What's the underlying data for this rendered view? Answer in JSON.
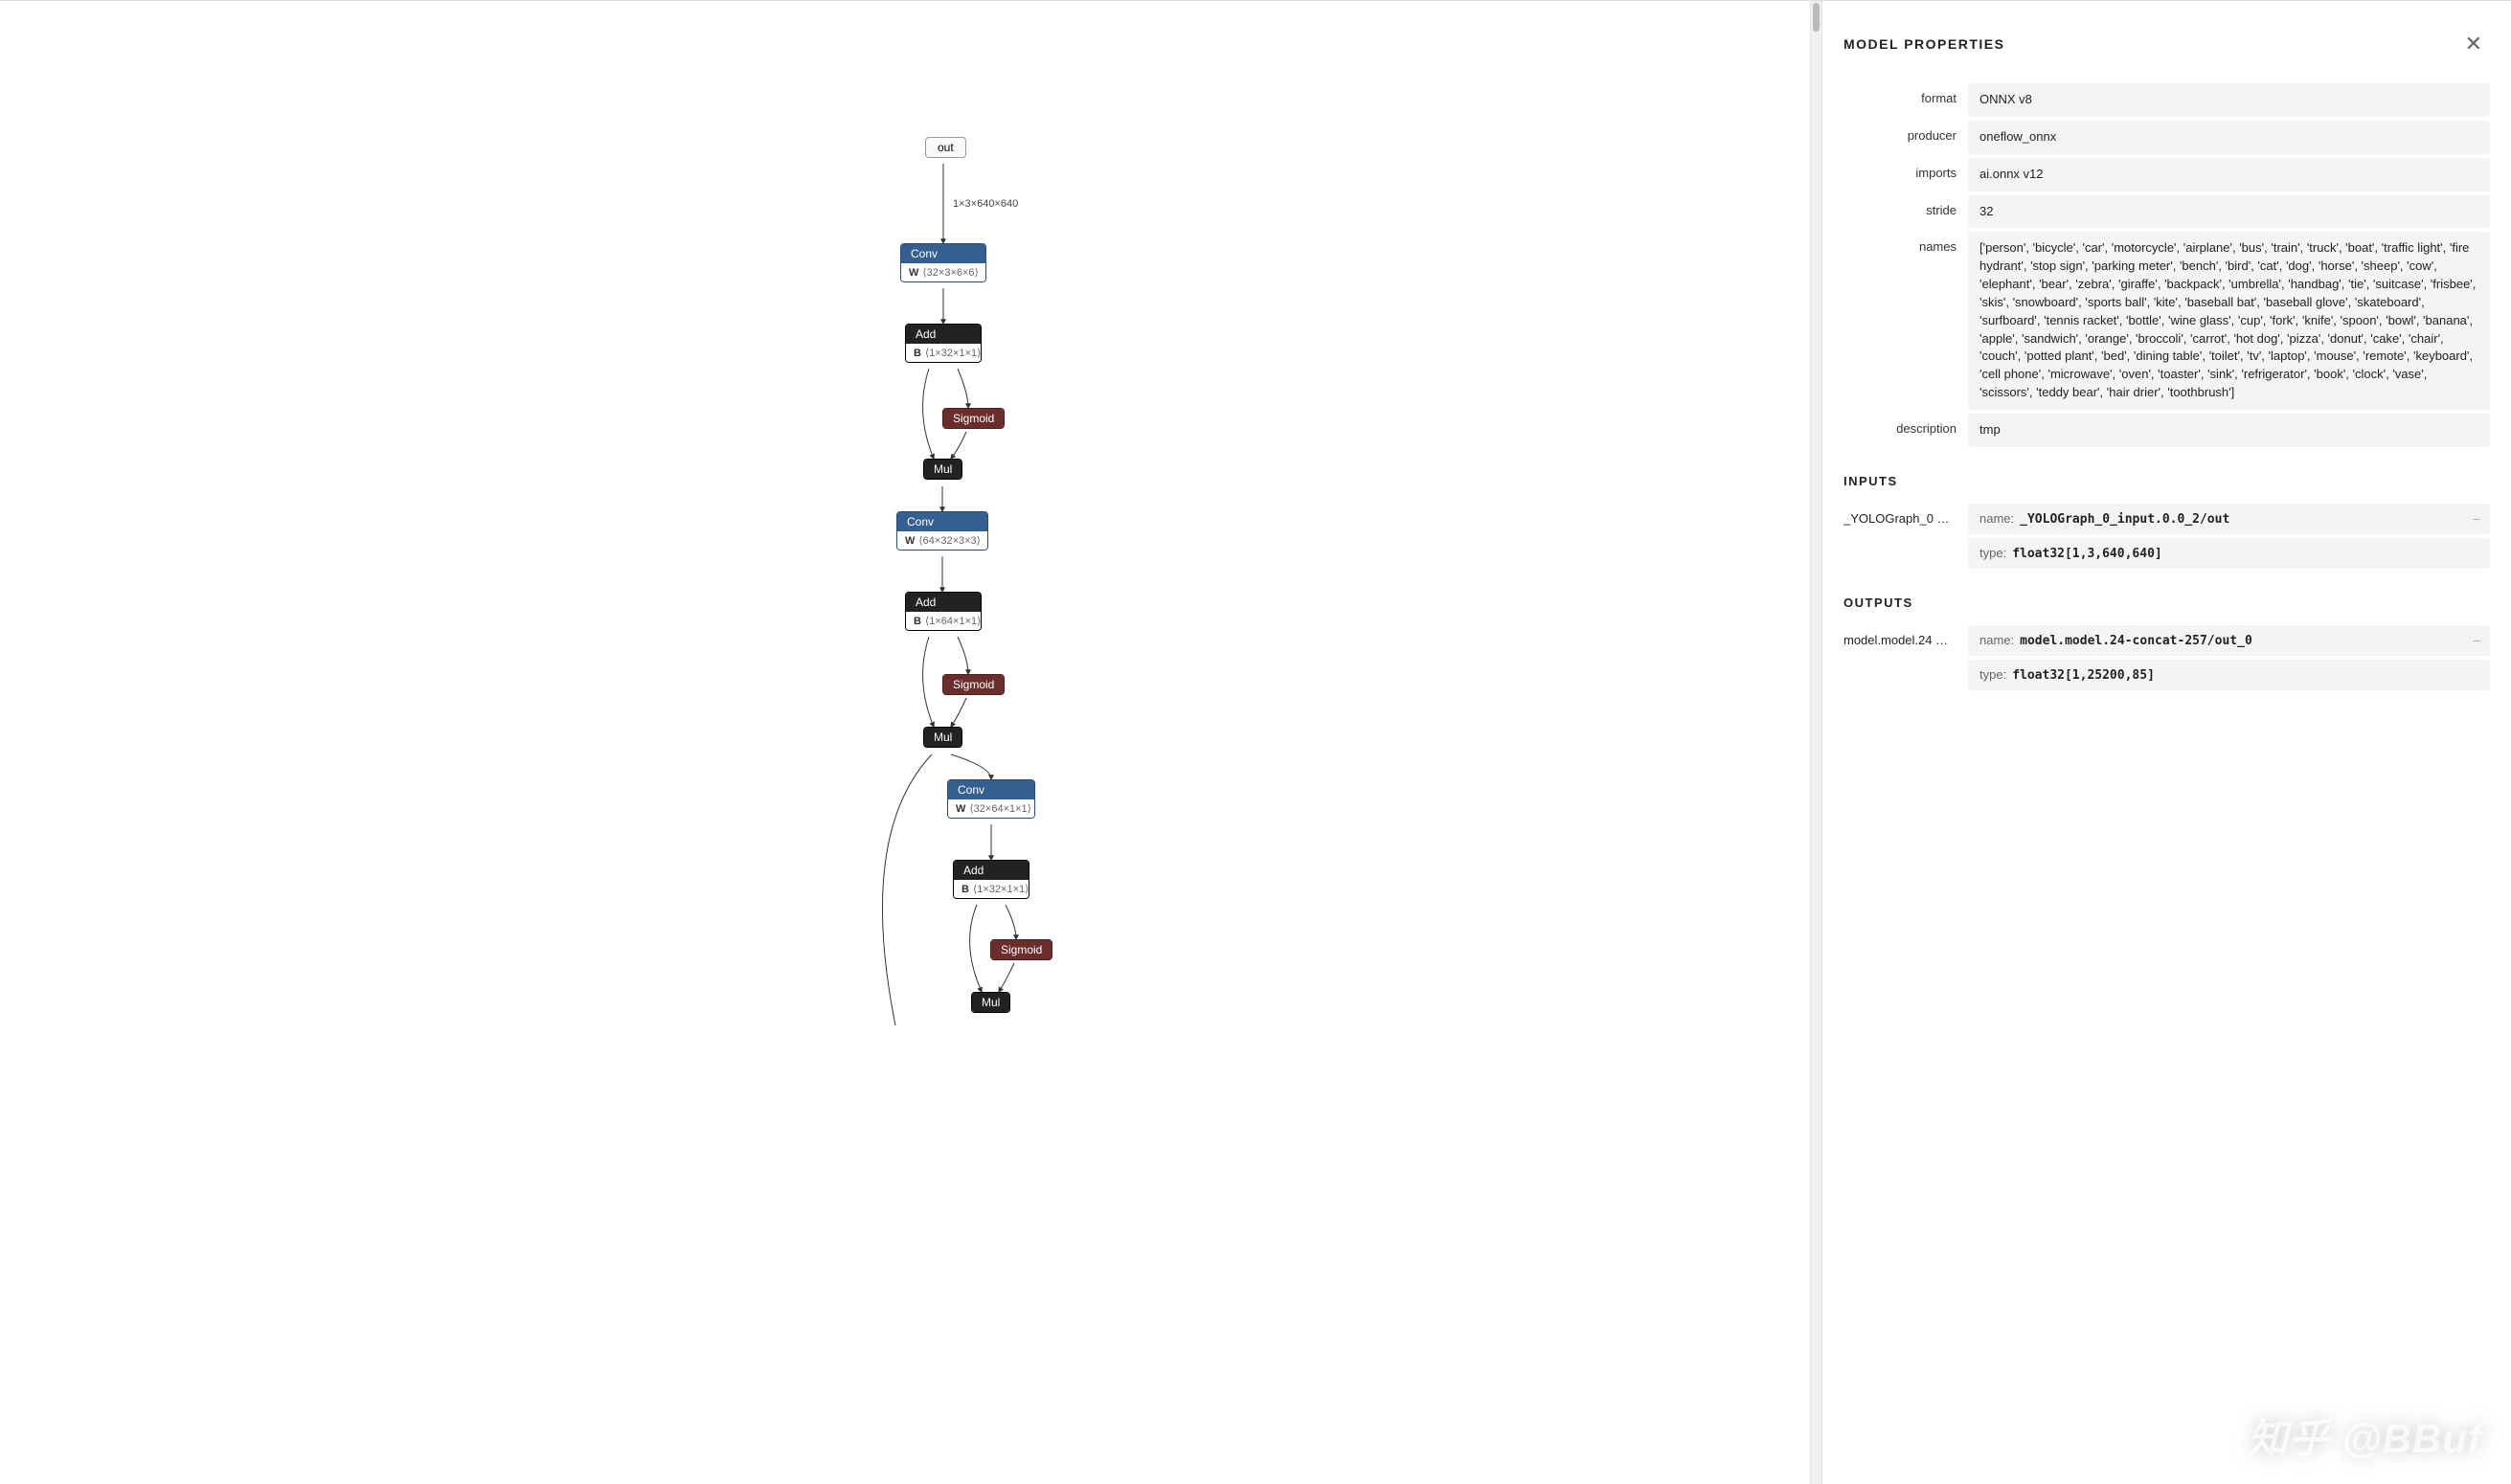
{
  "graph": {
    "out_label": "out",
    "edge_label": "1×3×640×640",
    "nodes": {
      "conv1": {
        "title": "Conv",
        "param_name": "W",
        "param_shape": "⟨32×3×6×6⟩"
      },
      "add1": {
        "title": "Add",
        "param_name": "B",
        "param_shape": "⟨1×32×1×1⟩"
      },
      "sig1": {
        "title": "Sigmoid"
      },
      "mul1": {
        "title": "Mul"
      },
      "conv2": {
        "title": "Conv",
        "param_name": "W",
        "param_shape": "⟨64×32×3×3⟩"
      },
      "add2": {
        "title": "Add",
        "param_name": "B",
        "param_shape": "⟨1×64×1×1⟩"
      },
      "sig2": {
        "title": "Sigmoid"
      },
      "mul2": {
        "title": "Mul"
      },
      "conv3": {
        "title": "Conv",
        "param_name": "W",
        "param_shape": "⟨32×64×1×1⟩"
      },
      "add3": {
        "title": "Add",
        "param_name": "B",
        "param_shape": "⟨1×32×1×1⟩"
      },
      "sig3": {
        "title": "Sigmoid"
      },
      "mul3": {
        "title": "Mul"
      }
    }
  },
  "panel": {
    "title": "MODEL PROPERTIES",
    "properties": {
      "format": {
        "label": "format",
        "value": "ONNX v8"
      },
      "producer": {
        "label": "producer",
        "value": "oneflow_onnx"
      },
      "imports": {
        "label": "imports",
        "value": "ai.onnx v12"
      },
      "stride": {
        "label": "stride",
        "value": "32"
      },
      "names": {
        "label": "names",
        "value": "['person', 'bicycle', 'car', 'motorcycle', 'airplane', 'bus', 'train', 'truck', 'boat', 'traffic light', 'fire hydrant', 'stop sign', 'parking meter', 'bench', 'bird', 'cat', 'dog', 'horse', 'sheep', 'cow', 'elephant', 'bear', 'zebra', 'giraffe', 'backpack', 'umbrella', 'handbag', 'tie', 'suitcase', 'frisbee', 'skis', 'snowboard', 'sports ball', 'kite', 'baseball bat', 'baseball glove', 'skateboard', 'surfboard', 'tennis racket', 'bottle', 'wine glass', 'cup', 'fork', 'knife', 'spoon', 'bowl', 'banana', 'apple', 'sandwich', 'orange', 'broccoli', 'carrot', 'hot dog', 'pizza', 'donut', 'cake', 'chair', 'couch', 'potted plant', 'bed', 'dining table', 'toilet', 'tv', 'laptop', 'mouse', 'remote', 'keyboard', 'cell phone', 'microwave', 'oven', 'toaster', 'sink', 'refrigerator', 'book', 'clock', 'vase', 'scissors', 'teddy bear', 'hair drier', 'toothbrush']"
      },
      "description": {
        "label": "description",
        "value": "tmp"
      }
    },
    "inputs_title": "INPUTS",
    "inputs": [
      {
        "label": "_YOLOGraph_0 …",
        "name_key": "name:",
        "name_val": "_YOLOGraph_0_input.0.0_2/out",
        "type_key": "type:",
        "type_val": "float32[1,3,640,640]"
      }
    ],
    "outputs_title": "OUTPUTS",
    "outputs": [
      {
        "label": "model.model.24 …",
        "name_key": "name:",
        "name_val": "model.model.24-concat-257/out_0",
        "type_key": "type:",
        "type_val": "float32[1,25200,85]"
      }
    ]
  },
  "watermark": "知乎 @BBuf"
}
